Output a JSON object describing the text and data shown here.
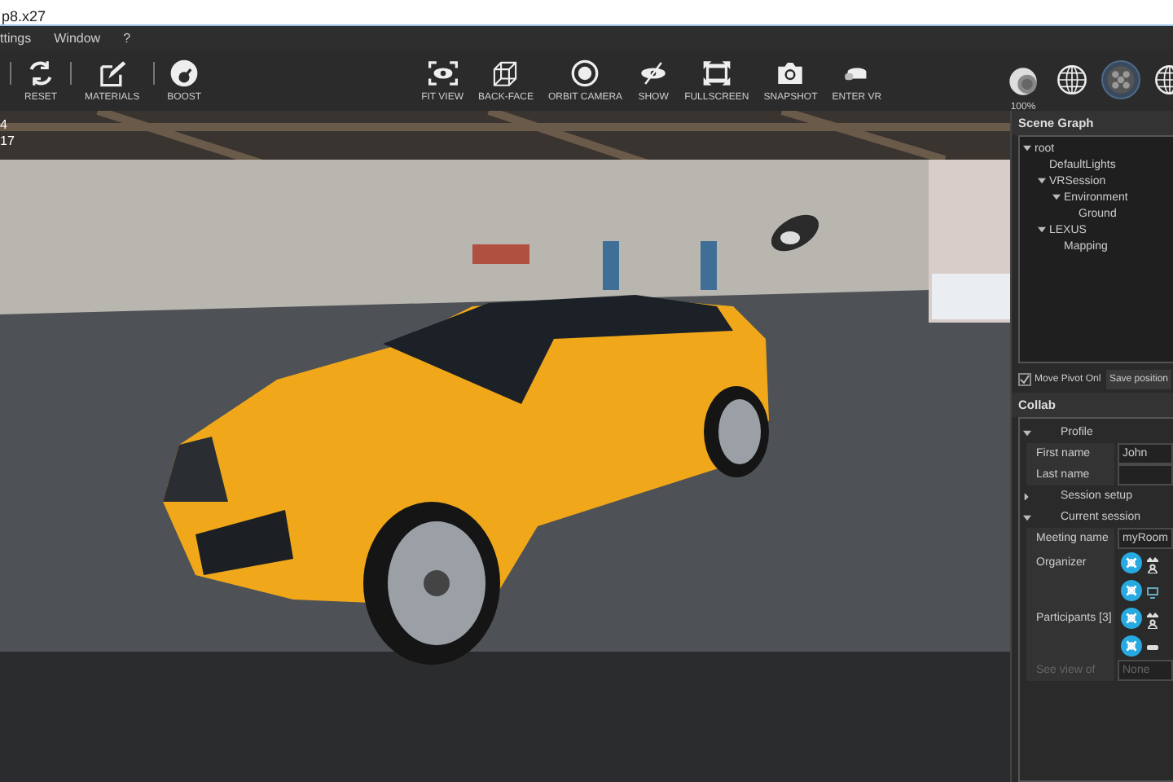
{
  "window": {
    "title": "p8.x27"
  },
  "menu": [
    "ttings",
    "Window",
    "?"
  ],
  "toolbar": {
    "left": [
      {
        "kind": "reset",
        "label": "RESET"
      },
      {
        "kind": "materials",
        "label": "MATERIALS"
      },
      {
        "kind": "boost",
        "label": "BOOST"
      }
    ],
    "center": [
      {
        "kind": "fit",
        "label": "FIT VIEW"
      },
      {
        "kind": "backface",
        "label": "BACK-FACE"
      },
      {
        "kind": "orbit",
        "label": "ORBIT CAMERA"
      },
      {
        "kind": "show",
        "label": "SHOW"
      },
      {
        "kind": "fullscreen",
        "label": "FULLSCREEN"
      },
      {
        "kind": "snapshot",
        "label": "SNAPSHOT"
      },
      {
        "kind": "vr",
        "label": "ENTER VR"
      }
    ],
    "view_modes": [
      {
        "kind": "shaded",
        "label": "100%",
        "selected": false
      },
      {
        "kind": "wireframe",
        "selected": false
      },
      {
        "kind": "textured",
        "selected": true
      },
      {
        "kind": "wireframe",
        "selected": false
      }
    ]
  },
  "viewport": {
    "stats": [
      "4",
      "17"
    ]
  },
  "scene_graph": {
    "title": "Scene Graph",
    "tree": [
      {
        "label": "root",
        "expanded": true,
        "children": [
          {
            "label": "DefaultLights"
          },
          {
            "label": "VRSession",
            "expanded": true,
            "children": [
              {
                "label": "Environment",
                "expanded": true,
                "children": [
                  {
                    "label": "Ground"
                  }
                ]
              }
            ]
          },
          {
            "label": "LEXUS",
            "expanded": true,
            "children": [
              {
                "label": "Mapping"
              }
            ]
          }
        ]
      }
    ],
    "move_pivot": {
      "label": "Move Pivot Onl",
      "checked": true
    },
    "save_button": "Save position"
  },
  "collab": {
    "title": "Collab",
    "rows": [
      {
        "kind": "section",
        "label": "Profile",
        "expanded": true
      },
      {
        "kind": "field",
        "label": "First name",
        "value": "John"
      },
      {
        "kind": "field",
        "label": "Last name"
      },
      {
        "kind": "section",
        "label": "Session setup",
        "expanded": false
      },
      {
        "kind": "section",
        "label": "Current session",
        "expanded": true
      },
      {
        "kind": "field",
        "label": "Meeting name",
        "value": "myRoom"
      },
      {
        "kind": "avatars",
        "label": "Organizer",
        "people": [
          {
            "kind": "host"
          }
        ]
      },
      {
        "kind": "avatars",
        "label": "Participants [3]",
        "people": [
          {
            "kind": "desktop"
          },
          {
            "kind": "host"
          },
          {
            "kind": "headset"
          }
        ]
      },
      {
        "kind": "field",
        "label": "See view of",
        "value": "None",
        "disabled": true
      }
    ]
  }
}
